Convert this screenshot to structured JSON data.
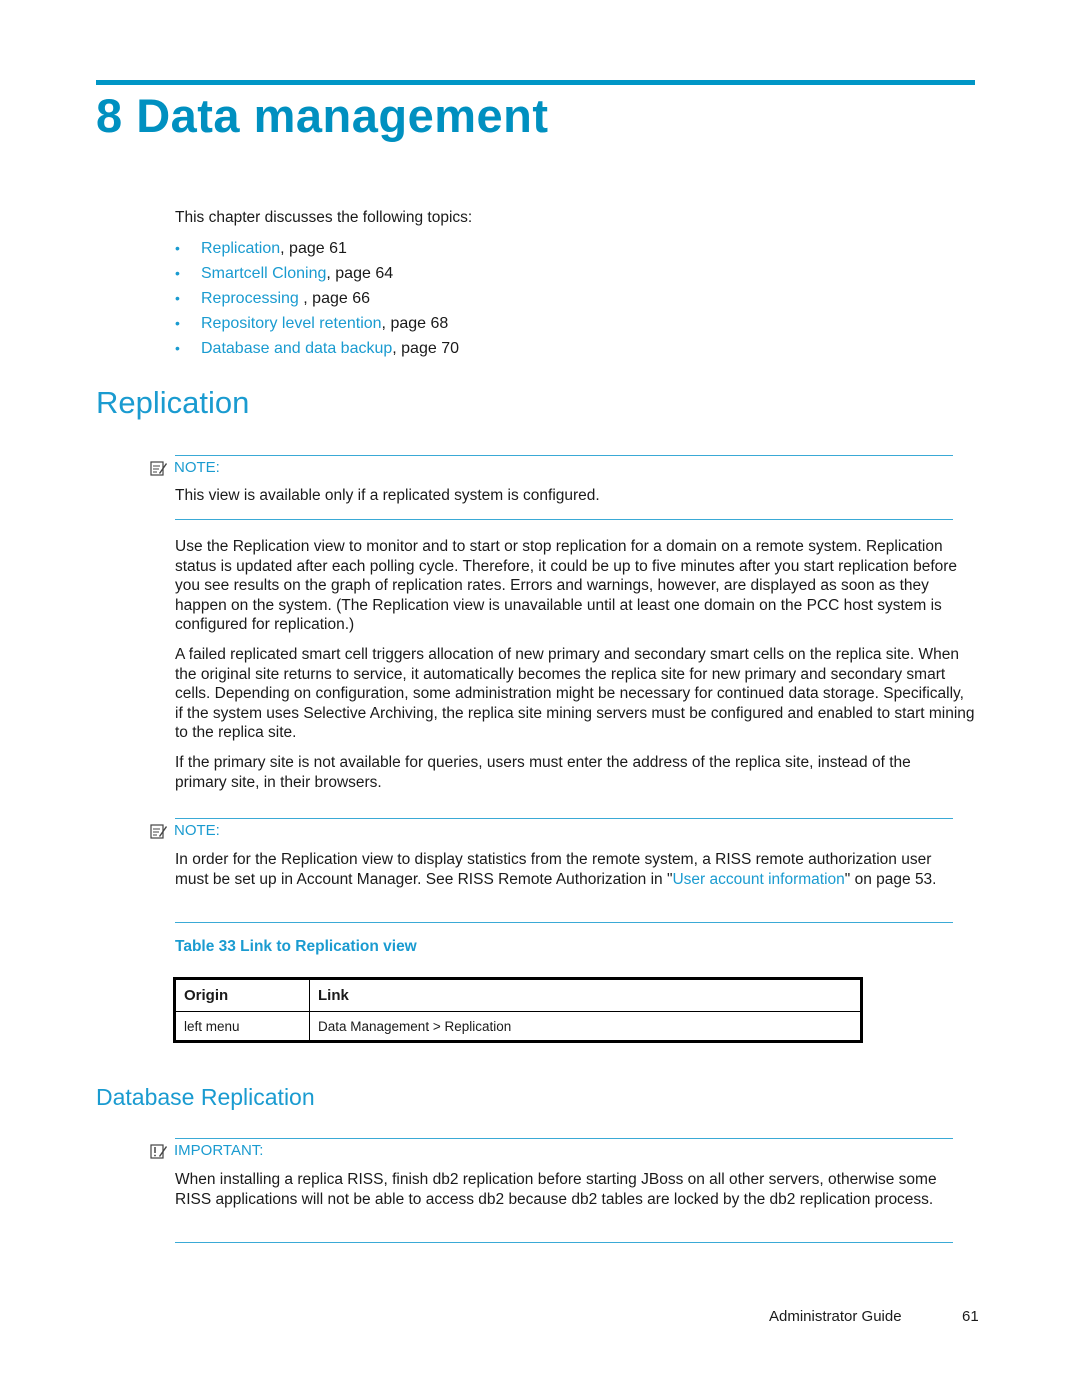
{
  "chapter": {
    "number": "8",
    "title": "8 Data management"
  },
  "intro": "This chapter discusses the following topics:",
  "toc": [
    {
      "link": "Replication",
      "suffix": ", page 61"
    },
    {
      "link": "Smartcell Cloning",
      "suffix": ", page 64"
    },
    {
      "link": "Reprocessing ",
      "suffix": ", page 66"
    },
    {
      "link": "Repository level retention",
      "suffix": ", page 68"
    },
    {
      "link": "Database and data backup",
      "suffix": ", page 70"
    }
  ],
  "section1": {
    "heading": "Replication",
    "note1": {
      "label": "NOTE:",
      "text": "This view is available only if a replicated system is configured."
    },
    "paragraphs": [
      "Use the Replication view to monitor and to start or stop replication for a domain on a remote system. Replication status is updated after each polling cycle.  Therefore, it could be up to five minutes after you start replication before you see results on the graph of replication rates.  Errors and warnings, however, are displayed as soon as they happen on the system.  (The Replication view is unavailable until at least one domain on the PCC host system is configured for replication.)",
      "A failed replicated smart cell triggers allocation of new primary and secondary smart cells on the replica site.  When the original site returns to service, it automatically becomes the replica site for new primary and secondary smart cells.  Depending on configuration, some administration might be necessary for continued data storage.  Specifically, if the system uses Selective Archiving, the replica site mining servers must be configured and enabled to start mining to the replica site.",
      "If the primary site is not available for queries, users must enter the address of the replica site, instead of the primary site, in their browsers."
    ],
    "note2": {
      "label": "NOTE:",
      "text_before": "In order for the Replication view to display statistics from the remote system, a RISS remote authorization user must be set up in Account Manager.  See RISS Remote Authorization in \"",
      "link": "User account information",
      "text_after": "\" on page 53."
    },
    "table": {
      "caption": "Table 33 Link to Replication view",
      "headers": [
        "Origin",
        "Link"
      ],
      "rows": [
        [
          "left menu",
          "Data Management > Replication"
        ]
      ]
    }
  },
  "section2": {
    "heading": "Database Replication",
    "important": {
      "label": "IMPORTANT:",
      "text": "When installing a replica RISS, finish db2 replication before starting JBoss on all other servers, otherwise some RISS applications will not be able to access db2 because db2 tables are locked by the db2 replication process."
    }
  },
  "footer": {
    "guide": "Administrator Guide",
    "page": "61"
  },
  "colors": {
    "accent": "#0096c6",
    "link": "#1a9bd0",
    "text": "#1a1a1a"
  }
}
